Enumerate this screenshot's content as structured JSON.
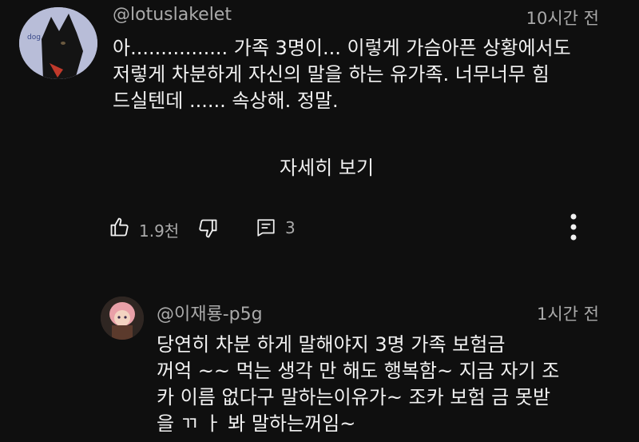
{
  "comment": {
    "author": "@lotuslakelet",
    "time": "10시간 전",
    "lines": [
      "아................ 가족 3명이... 이렇게 가슴아픈 상황에서도",
      "저렇게 차분하게 자신의 말을 하는 유가족. 너무너무 힘",
      "드실텐데 ...... 속상해. 정말."
    ],
    "show_more": "자세히 보기",
    "likes": "1.9천",
    "replies": "3"
  },
  "reply": {
    "author": "@이재룡-p5g",
    "time": "1시간 전",
    "lines": [
      "당연히  차분 하게 말해야지     3명 가족  보험금",
      "꺼억 ~~ 먹는 생각 만 해도 행복함~ 지금 자기 조",
      "카 이름 없다구 말하는이유가~     조카 보험 금 못받",
      "을 ㄲ ㅏ 봐 말하는꺼임~"
    ]
  },
  "icons": {
    "like": "thumbs-up-icon",
    "dislike": "thumbs-down-icon",
    "reply": "comment-icon",
    "more": "more-vert-icon"
  }
}
